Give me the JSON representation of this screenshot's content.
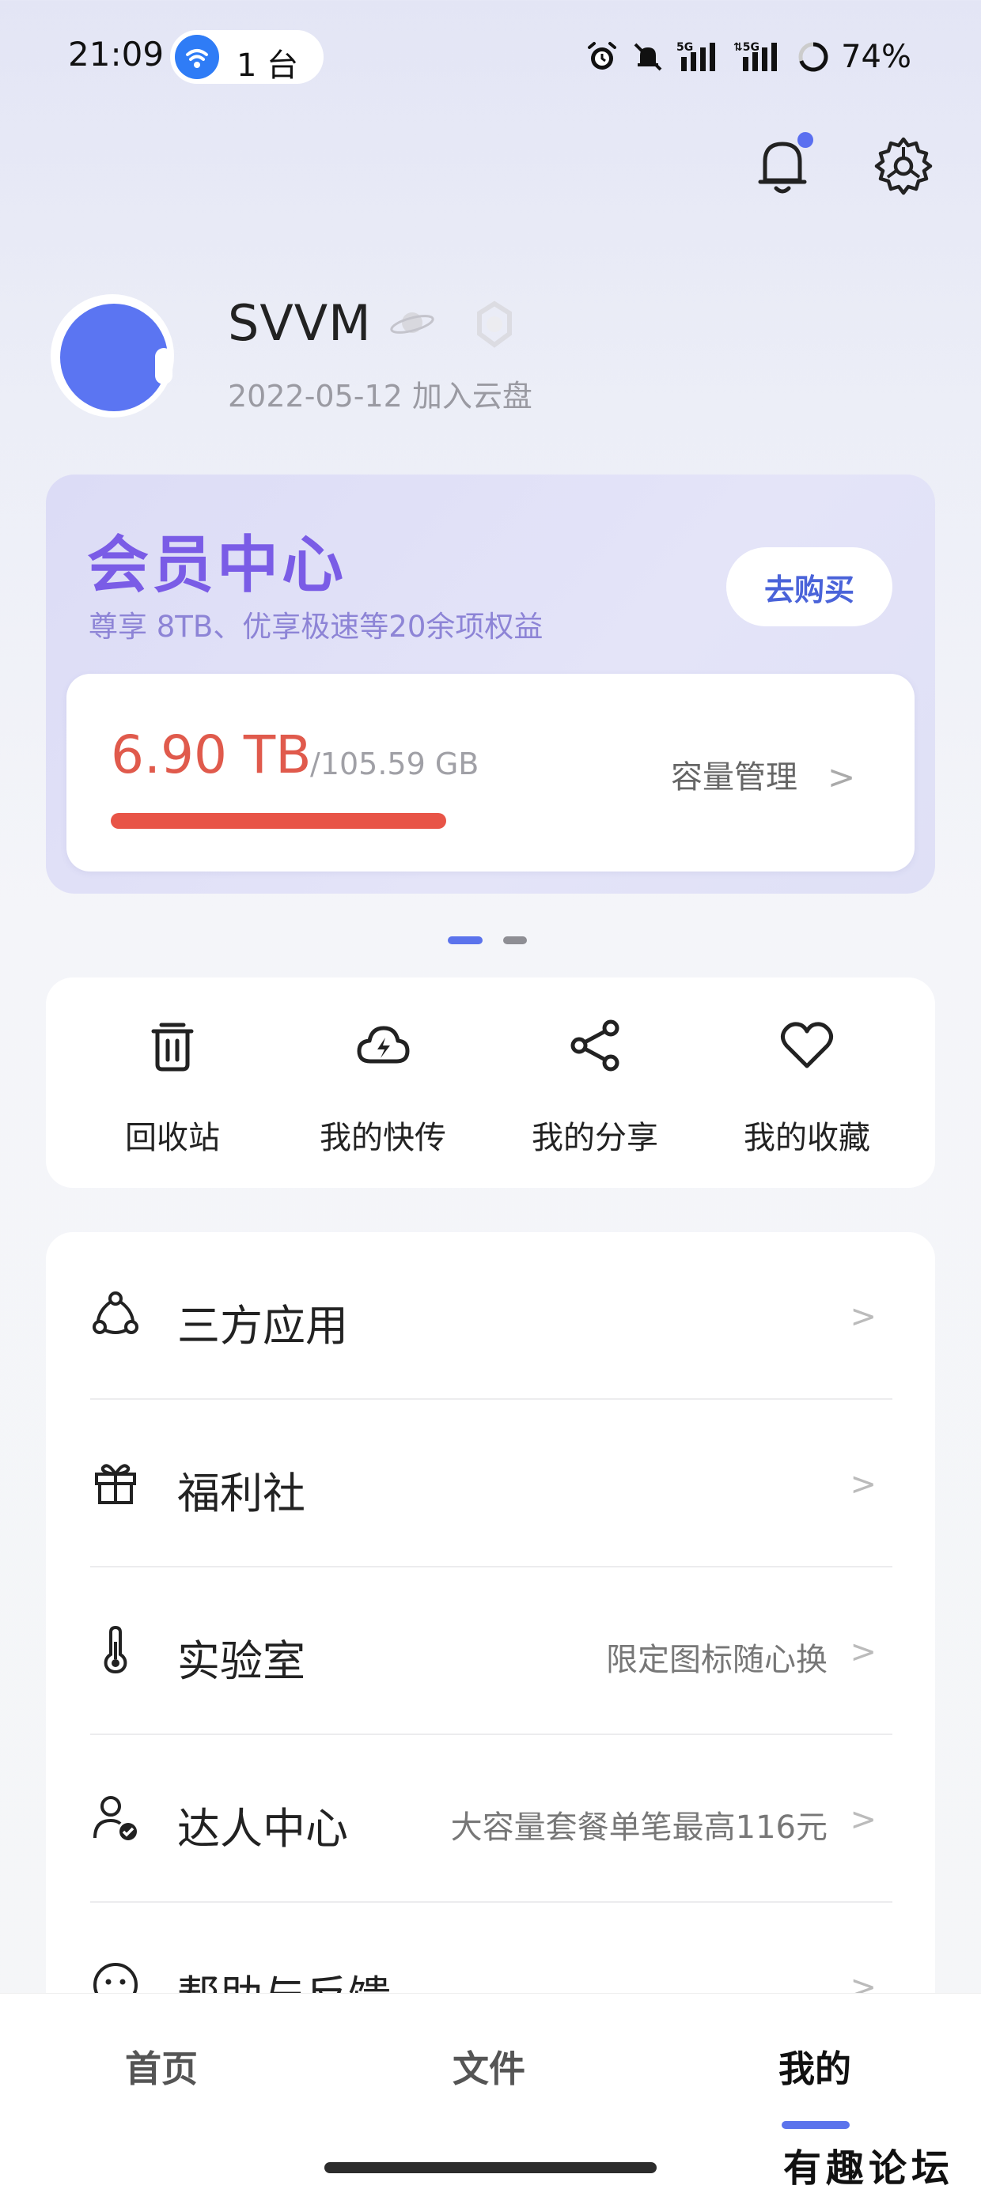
{
  "status_bar": {
    "time": "21:09",
    "hotspot_count": "1 台",
    "battery": "74%",
    "icons": [
      "alarm-icon",
      "mute-icon",
      "signal-5g-icon",
      "signal-5g-icon",
      "battery-ring-icon"
    ]
  },
  "header": {
    "icons": [
      "bell-icon",
      "settings-icon"
    ],
    "notification_dot_color": "#5a6ff0"
  },
  "profile": {
    "username": "SVVM",
    "joined": "2022-05-12 加入云盘",
    "avatar_color": "#5b75f2"
  },
  "member_card": {
    "title": "会员中心",
    "subtitle": "尊享 8TB、优享极速等20余项权益",
    "buy_label": "去购买",
    "storage_used": "6.90 TB",
    "storage_total": "/105.59 GB",
    "capacity_link": "容量管理",
    "chevron": ">",
    "usage_fill_fraction": 0.4,
    "accent_color": "#e85447"
  },
  "pager": {
    "count": 2,
    "active": 0
  },
  "quick_actions": [
    {
      "label": "回收站",
      "icon": "trash-icon"
    },
    {
      "label": "我的快传",
      "icon": "cloud-bolt-icon"
    },
    {
      "label": "我的分享",
      "icon": "share-icon"
    },
    {
      "label": "我的收藏",
      "icon": "heart-icon"
    }
  ],
  "menu": [
    {
      "title": "三方应用",
      "hint": "",
      "icon": "apps-icon",
      "chevron": ">"
    },
    {
      "title": "福利社",
      "hint": "",
      "icon": "gift-icon",
      "chevron": ">"
    },
    {
      "title": "实验室",
      "hint": "限定图标随心换",
      "icon": "thermometer-icon",
      "chevron": ">"
    },
    {
      "title": "达人中心",
      "hint": "大容量套餐单笔最高116元",
      "icon": "user-verified-icon",
      "chevron": ">"
    },
    {
      "title": "帮助与反馈",
      "hint": "",
      "icon": "smile-icon",
      "chevron": ">"
    }
  ],
  "bottom_nav": {
    "items": [
      "首页",
      "文件",
      "我的"
    ],
    "active": 2
  },
  "watermark": "有趣论坛"
}
